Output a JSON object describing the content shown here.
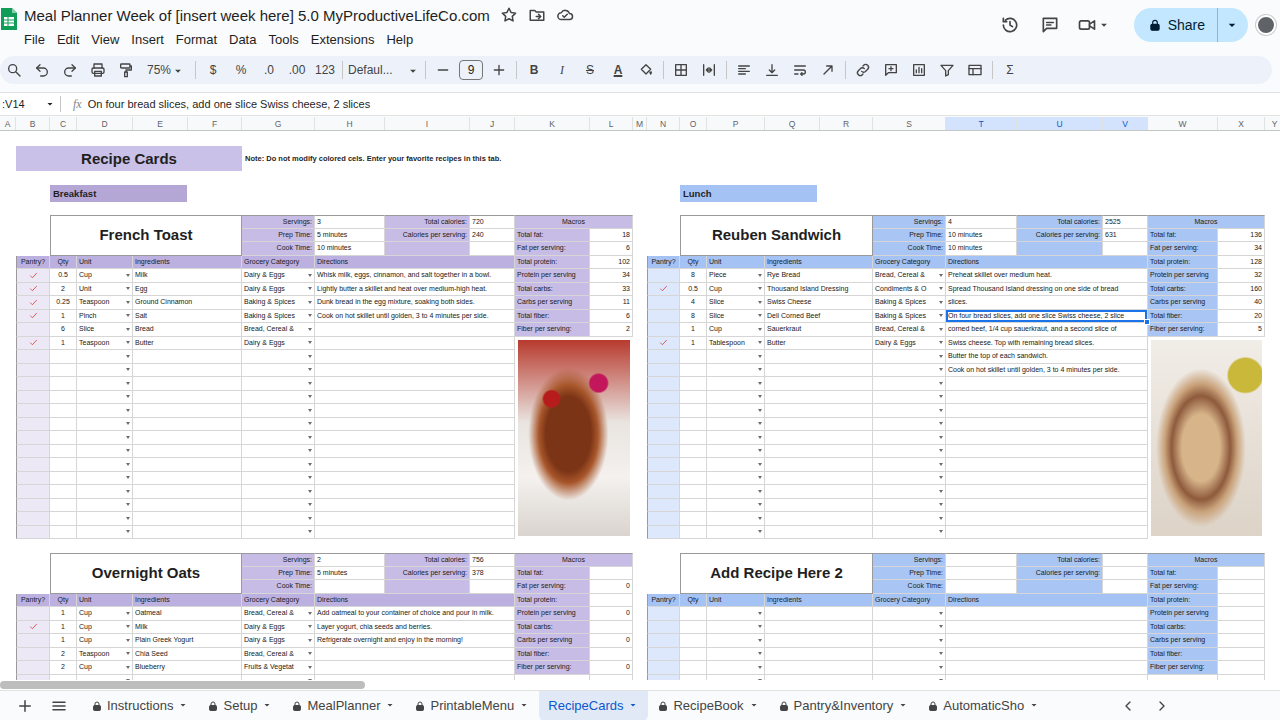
{
  "window": {
    "title": "Meal Planner Week of [insert week here] 5.0 MyProductiveLifeCo.com"
  },
  "menu": [
    "File",
    "Edit",
    "View",
    "Insert",
    "Format",
    "Data",
    "Tools",
    "Extensions",
    "Help"
  ],
  "share": {
    "label": "Share"
  },
  "toolbar": {
    "zoom": "75%",
    "currency": "$",
    "percent": "%",
    "decrease_decimal": ".0",
    "increase_decimal": ".00",
    "number_format": "123",
    "font": "Defaul...",
    "font_size": "9",
    "bold": "B",
    "italic": "I",
    "strikethrough": "S",
    "text_color": "A",
    "functions": "Σ"
  },
  "formula_bar": {
    "name_box": ":V14",
    "fx": "fx",
    "value": "On four bread slices, add one slice Swiss cheese, 2 slices"
  },
  "columns": [
    {
      "label": "A",
      "selected": false
    },
    {
      "label": "B",
      "selected": false
    },
    {
      "label": "C",
      "selected": false
    },
    {
      "label": "D",
      "selected": false
    },
    {
      "label": "E",
      "selected": false
    },
    {
      "label": "F",
      "selected": false
    },
    {
      "label": "G",
      "selected": false
    },
    {
      "label": "H",
      "selected": false
    },
    {
      "label": "I",
      "selected": false
    },
    {
      "label": "J",
      "selected": false
    },
    {
      "label": "K",
      "selected": false
    },
    {
      "label": "L",
      "selected": false
    },
    {
      "label": "M",
      "selected": false
    },
    {
      "label": "N",
      "selected": false
    },
    {
      "label": "O",
      "selected": false
    },
    {
      "label": "P",
      "selected": false
    },
    {
      "label": "Q",
      "selected": false
    },
    {
      "label": "R",
      "selected": false
    },
    {
      "label": "S",
      "selected": false
    },
    {
      "label": "T",
      "selected": true
    },
    {
      "label": "U",
      "selected": true
    },
    {
      "label": "V",
      "selected": true
    },
    {
      "label": "W",
      "selected": false
    },
    {
      "label": "X",
      "selected": false
    },
    {
      "label": "Y",
      "selected": false
    }
  ],
  "sheet": {
    "title": "Recipe Cards",
    "note": "Note: Do not modify colored cels. Enter your favorite recipes in this tab."
  },
  "sections": [
    {
      "label": "Breakfast",
      "kind": "breakfast",
      "cards": [
        {
          "title": "French Toast",
          "photo": true,
          "info": [
            {
              "label": "Servings:",
              "value": "3"
            },
            {
              "label": "Prep Time:",
              "value": "5 minutes"
            },
            {
              "label": "Cook Time:",
              "value": "10 minutes"
            }
          ],
          "calories": [
            {
              "label": "Total calories:",
              "value": "720"
            },
            {
              "label": "Calories per serving:",
              "value": "240"
            }
          ],
          "macros_title": "Macros",
          "macros": [
            {
              "label": "Total fat:",
              "value": "18"
            },
            {
              "label": "Fat per serving:",
              "value": "6"
            },
            {
              "label": "Total protein:",
              "value": "102"
            },
            {
              "label": "Protein per serving",
              "value": "34"
            },
            {
              "label": "Total carbs:",
              "value": "33"
            },
            {
              "label": "Carbs per serving",
              "value": "11"
            },
            {
              "label": "Total fiber:",
              "value": "6"
            },
            {
              "label": "Fiber per serving:",
              "value": "2"
            }
          ],
          "headers": {
            "pantry": "Pantry?",
            "qty": "Qty",
            "unit": "Unit",
            "ingredients": "Ingredients",
            "category": "Grocery Category",
            "directions": "Directions"
          },
          "ingredients": [
            {
              "pantry": true,
              "qty": "0.5",
              "unit": "Cup",
              "name": "Milk",
              "category": "Dairy & Eggs"
            },
            {
              "pantry": true,
              "qty": "2",
              "unit": "Unit",
              "name": "Egg",
              "category": "Dairy & Eggs"
            },
            {
              "pantry": true,
              "qty": "0.25",
              "unit": "Teaspoon",
              "name": "Ground Cinnamon",
              "category": "Baking & Spices"
            },
            {
              "pantry": true,
              "qty": "1",
              "unit": "Pinch",
              "name": "Salt",
              "category": "Baking & Spices"
            },
            {
              "pantry": false,
              "qty": "6",
              "unit": "Slice",
              "name": "Bread",
              "category": "Bread, Cereal &"
            },
            {
              "pantry": true,
              "qty": "1",
              "unit": "Teaspoon",
              "name": "Butter",
              "category": "Dairy & Eggs"
            }
          ],
          "directions": [
            {
              "text": "Whisk milk, eggs, cinnamon, and salt together in a bowl.",
              "selected": false
            },
            {
              "text": "Lightly butter a skillet and heat over medium-high heat.",
              "selected": false
            },
            {
              "text": "Dunk bread in the egg mixture, soaking both sides.",
              "selected": false
            },
            {
              "text": "Cook on hot skillet until golden, 3 to 4 minutes per side.",
              "selected": false
            }
          ]
        },
        {
          "title": "Overnight Oats",
          "photo": false,
          "info": [
            {
              "label": "Servings:",
              "value": "2"
            },
            {
              "label": "Prep Time:",
              "value": "5 minutes"
            },
            {
              "label": "Cook Time:"
            }
          ],
          "calories": [
            {
              "label": "Total calories:",
              "value": "756"
            },
            {
              "label": "Calories per serving:",
              "value": "378"
            }
          ],
          "macros_title": "Macros",
          "macros": [
            {
              "label": "Total fat:"
            },
            {
              "label": "Fat per serving:",
              "value": "0"
            },
            {
              "label": "Total protein:"
            },
            {
              "label": "Protein per serving",
              "value": "0"
            },
            {
              "label": "Total carbs:"
            },
            {
              "label": "Carbs per serving",
              "value": "0"
            },
            {
              "label": "Total fiber:"
            },
            {
              "label": "Fiber per serving:",
              "value": "0"
            }
          ],
          "headers": {
            "pantry": "Pantry?",
            "qty": "Qty",
            "unit": "Unit",
            "ingredients": "Ingredients",
            "category": "Grocery Category",
            "directions": "Directions"
          },
          "ingredients": [
            {
              "pantry": false,
              "qty": "1",
              "unit": "Cup",
              "name": "Oatmeal",
              "category": "Bread, Cereal &"
            },
            {
              "pantry": true,
              "qty": "1",
              "unit": "Cup",
              "name": "Milk",
              "category": "Dairy & Eggs"
            },
            {
              "pantry": false,
              "qty": "1",
              "unit": "Cup",
              "name": "Plain Greek Yogurt",
              "category": "Dairy & Eggs"
            },
            {
              "pantry": false,
              "qty": "2",
              "unit": "Teaspoon",
              "name": "Chia Seed",
              "category": "Bread, Cereal &"
            },
            {
              "pantry": false,
              "qty": "2",
              "unit": "Cup",
              "name": "Blueberry",
              "category": "Fruits & Vegetat"
            }
          ],
          "directions": [
            {
              "text": "Add oatmeal to your container of choice and pour in milk.",
              "selected": false
            },
            {
              "text": "Layer yogurt, chia seeds and berries.",
              "selected": false
            },
            {
              "text": "Refrigerate overnight and enjoy in the morning!",
              "selected": false
            }
          ]
        }
      ]
    },
    {
      "label": "Lunch",
      "kind": "lunch",
      "cards": [
        {
          "title": "Reuben Sandwich",
          "photo": true,
          "info": [
            {
              "label": "Servings:",
              "value": "4"
            },
            {
              "label": "Prep Time:",
              "value": "10 minutes"
            },
            {
              "label": "Cook Time:",
              "value": "10 minutes"
            }
          ],
          "calories": [
            {
              "label": "Total calories:",
              "value": "2525"
            },
            {
              "label": "Calories per serving:",
              "value": "631"
            }
          ],
          "macros_title": "Macros",
          "macros": [
            {
              "label": "Total fat:",
              "value": "136"
            },
            {
              "label": "Fat per serving:",
              "value": "34"
            },
            {
              "label": "Total protein:",
              "value": "128"
            },
            {
              "label": "Protein per serving",
              "value": "32"
            },
            {
              "label": "Total carbs:",
              "value": "160"
            },
            {
              "label": "Carbs per serving",
              "value": "40"
            },
            {
              "label": "Total fiber:",
              "value": "20"
            },
            {
              "label": "Fiber per serving:",
              "value": "5"
            }
          ],
          "headers": {
            "pantry": "Pantry?",
            "qty": "Qty",
            "unit": "Unit",
            "ingredients": "Ingredients",
            "category": "Grocery Category",
            "directions": "Directions"
          },
          "ingredients": [
            {
              "pantry": false,
              "qty": "8",
              "unit": "Piece",
              "name": "Rye Bread",
              "category": "Bread, Cereal &"
            },
            {
              "pantry": true,
              "qty": "0.5",
              "unit": "Cup",
              "name": "Thousand Island Dressing",
              "category": "Condiments & O"
            },
            {
              "pantry": false,
              "qty": "4",
              "unit": "Slice",
              "name": "Swiss Cheese",
              "category": "Baking & Spices"
            },
            {
              "pantry": false,
              "qty": "8",
              "unit": "Slice",
              "name": "Deli Corned Beef",
              "category": "Baking & Spices"
            },
            {
              "pantry": false,
              "qty": "1",
              "unit": "Cup",
              "name": "Sauerkraut",
              "category": "Bread, Cereal &"
            },
            {
              "pantry": true,
              "qty": "1",
              "unit": "Tablespoon",
              "name": "Butter",
              "category": "Dairy & Eggs"
            }
          ],
          "directions": [
            {
              "text": "Preheat skillet over medium heat.",
              "selected": false
            },
            {
              "text": "Spread Thousand Island dressing on one side of bread",
              "selected": false
            },
            {
              "text": "slices.",
              "selected": false
            },
            {
              "text": "On four bread slices, add one slice Swiss cheese, 2 slice",
              "selected": true
            },
            {
              "text": "corned beef, 1/4 cup sauerkraut, and a second slice of",
              "selected": false
            },
            {
              "text": "Swiss cheese. Top with remaining bread slices.",
              "selected": false
            },
            {
              "text": "Butter the top of each sandwich.",
              "selected": false
            },
            {
              "text": "Cook on hot skillet until golden, 3 to 4 minutes per side.",
              "selected": false
            }
          ]
        },
        {
          "title": "Add Recipe Here 2",
          "photo": false,
          "info": [
            {
              "label": "Servings:"
            },
            {
              "label": "Prep Time:"
            },
            {
              "label": "Cook Time:"
            }
          ],
          "calories": [
            {
              "label": "Total calories:"
            },
            {
              "label": "Calories per serving:"
            }
          ],
          "macros_title": "Macros",
          "macros": [
            {
              "label": "Total fat:"
            },
            {
              "label": "Fat per serving:"
            },
            {
              "label": "Total protein:"
            },
            {
              "label": "Protein per serving"
            },
            {
              "label": "Total carbs:"
            },
            {
              "label": "Carbs per serving"
            },
            {
              "label": "Total fiber:"
            },
            {
              "label": "Fiber per serving:"
            }
          ],
          "headers": {
            "pantry": "Pantry?",
            "qty": "Qty",
            "unit": "Unit",
            "ingredients": "Ingredients",
            "category": "Grocery Category",
            "directions": "Directions"
          },
          "ingredients": [],
          "directions": []
        }
      ]
    }
  ],
  "sheet_tabs": [
    {
      "label": "Instructions",
      "locked": true,
      "selected": false
    },
    {
      "label": "Setup",
      "locked": true,
      "selected": false
    },
    {
      "label": "MealPlanner",
      "locked": true,
      "selected": false
    },
    {
      "label": "PrintableMenu",
      "locked": true,
      "selected": false
    },
    {
      "label": "RecipeCards",
      "locked": false,
      "selected": true
    },
    {
      "label": "RecipeBook",
      "locked": true,
      "selected": false
    },
    {
      "label": "Pantry&Inventory",
      "locked": true,
      "selected": false
    },
    {
      "label": "AutomaticSho",
      "locked": true,
      "selected": false
    }
  ]
}
